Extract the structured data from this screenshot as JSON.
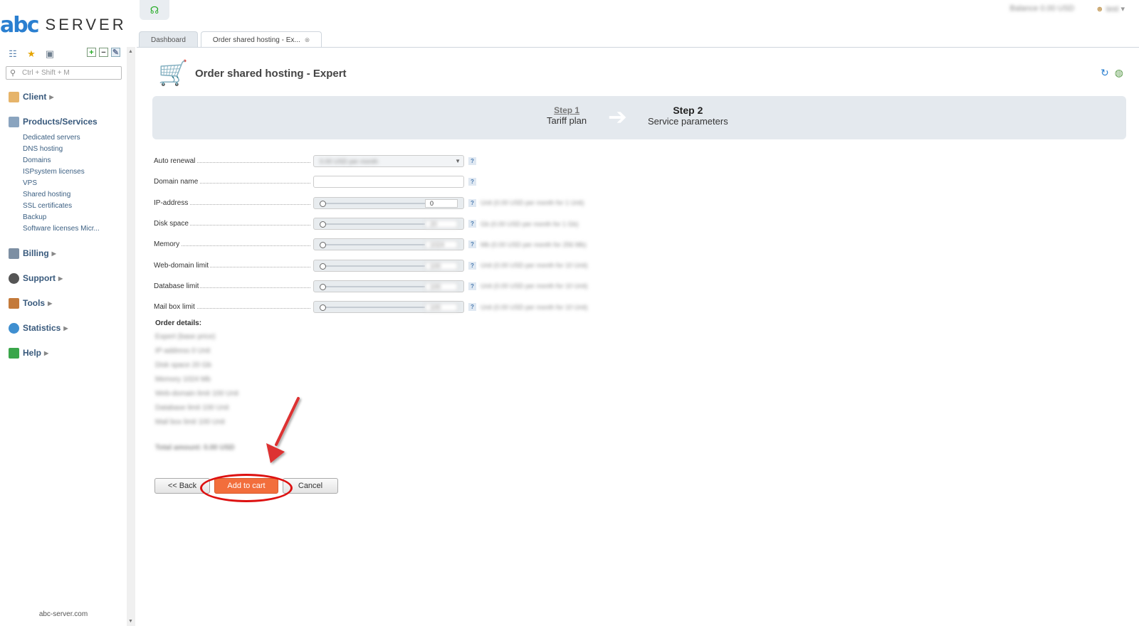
{
  "brand": {
    "logo_mark": "abc",
    "logo_text": "SERVER",
    "footer": "abc-server.com"
  },
  "sidebar": {
    "search_placeholder": "Ctrl + Shift + M",
    "menu": {
      "client": "Client",
      "products": "Products/Services",
      "billing": "Billing",
      "support": "Support",
      "tools": "Tools",
      "statistics": "Statistics",
      "help": "Help"
    },
    "products_items": [
      "Dedicated servers",
      "DNS hosting",
      "Domains",
      "ISPsystem licenses",
      "VPS",
      "Shared hosting",
      "SSL certificates",
      "Backup",
      "Software licenses Micr..."
    ]
  },
  "topbar": {
    "balance": "Balance 0.00 USD",
    "user": "test"
  },
  "tabs": {
    "dashboard": "Dashboard",
    "active": "Order shared hosting - Ex..."
  },
  "page": {
    "title": "Order shared hosting - Expert"
  },
  "steps": {
    "step1_title": "Step 1",
    "step1_sub": "Tariff plan",
    "step2_title": "Step 2",
    "step2_sub": "Service parameters"
  },
  "form": {
    "auto_renewal": {
      "label": "Auto renewal",
      "value": "0.00 USD per month"
    },
    "domain_name": {
      "label": "Domain name",
      "value": ""
    },
    "ip_address": {
      "label": "IP-address",
      "value": "0",
      "hint": "Unit (0.00 USD per month for 1 Unit)"
    },
    "disk_space": {
      "label": "Disk space",
      "value": "20",
      "hint": "Gb (0.00 USD per month for 1 Gb)"
    },
    "memory": {
      "label": "Memory",
      "value": "1024",
      "hint": "Mb (0.00 USD per month for 256 Mb)"
    },
    "web_domain_limit": {
      "label": "Web-domain limit",
      "value": "100",
      "hint": "Unit (0.00 USD per month for 10 Unit)"
    },
    "database_limit": {
      "label": "Database limit",
      "value": "100",
      "hint": "Unit (0.00 USD per month for 10 Unit)"
    },
    "mailbox_limit": {
      "label": "Mail box limit",
      "value": "100",
      "hint": "Unit (0.00 USD per month for 10 Unit)"
    }
  },
  "details": {
    "title": "Order details:",
    "lines": [
      "Expert (base price)",
      "IP-address 0 Unit",
      "Disk space 20 Gb",
      "Memory 1024 Mb",
      "Web-domain limit 100 Unit",
      "Database limit 100 Unit",
      "Mail box limit 100 Unit"
    ],
    "total": "Total amount: 0.00 USD"
  },
  "buttons": {
    "back": "<< Back",
    "add": "Add to cart",
    "cancel": "Cancel"
  },
  "colors": {
    "accent": "#f26e3c",
    "annotation": "#dd1111",
    "link": "#38597c"
  }
}
